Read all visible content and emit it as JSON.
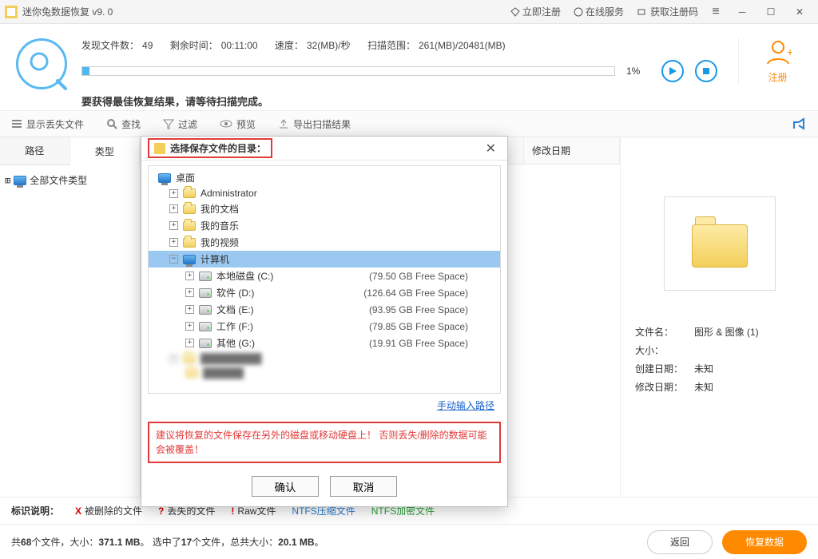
{
  "titlebar": {
    "app_title": "迷你兔数据恢复 v9. 0",
    "links": {
      "register_now": "立即注册",
      "online_service": "在线服务",
      "get_reg_code": "获取注册码"
    }
  },
  "status": {
    "labels": {
      "found": "发现文件数：",
      "remaining": "剩余时间：",
      "speed": "速度：",
      "range": "扫描范围："
    },
    "values": {
      "found": "49",
      "remaining": "00:11:00",
      "speed": "32(MB)/秒",
      "range": "261(MB)/20481(MB)"
    },
    "percent": "1%",
    "progress_pct": 1,
    "tip": "要获得最佳恢复结果，请等待扫描完成。"
  },
  "register_side": {
    "label": "注册"
  },
  "toolbar": {
    "show_lost": "显示丢失文件",
    "find": "查找",
    "filter": "过滤",
    "preview": "预览",
    "export": "导出扫描结果"
  },
  "tabs": {
    "path": "路径",
    "type": "类型"
  },
  "tree_root": "全部文件类型",
  "table": {
    "col_mod": "修改日期"
  },
  "preview": {
    "fields": {
      "name": "文件名：",
      "size": "大小：",
      "created": "创建日期：",
      "modified": "修改日期："
    },
    "values": {
      "name": "图形 & 图像 (1)",
      "size": "",
      "created": "未知",
      "modified": "未知"
    }
  },
  "legend": {
    "label": "标识说明：",
    "deleted": "被删除的文件",
    "lost": "丢失的文件",
    "raw": "Raw文件",
    "ntfs_comp": "NTFS压缩文件",
    "ntfs_enc": "NTFS加密文件"
  },
  "footer": {
    "summary_prefix": "共",
    "total_files": "68",
    "summary_mid1": "个文件，大小：",
    "total_size": "371.1 MB",
    "summary_mid2": "。 选中了",
    "selected_files": "17",
    "summary_mid3": "个文件，总共大小：",
    "selected_size": "20.1 MB",
    "summary_suffix": "。",
    "back": "返回",
    "recover": "恢复数据"
  },
  "dialog": {
    "title": "选择保存文件的目录：",
    "nodes": {
      "desktop": "桌面",
      "admin": "Administrator",
      "documents": "我的文档",
      "music": "我的音乐",
      "video": "我的视频",
      "computer": "计算机"
    },
    "drives": [
      {
        "label": "本地磁盘 (C:)",
        "free": "(79.50 GB Free Space)"
      },
      {
        "label": "软件 (D:)",
        "free": "(126.64 GB Free Space)"
      },
      {
        "label": "文档 (E:)",
        "free": "(93.95 GB Free Space)"
      },
      {
        "label": "工作 (F:)",
        "free": "(79.85 GB Free Space)"
      },
      {
        "label": "其他 (G:)",
        "free": "(19.91 GB Free Space)"
      }
    ],
    "manual_link": "手动输入路径",
    "warning": "建议将恢复的文件保存在另外的磁盘或移动硬盘上！ 否则丢失/删除的数据可能会被覆盖！",
    "ok": "确认",
    "cancel": "取消"
  }
}
